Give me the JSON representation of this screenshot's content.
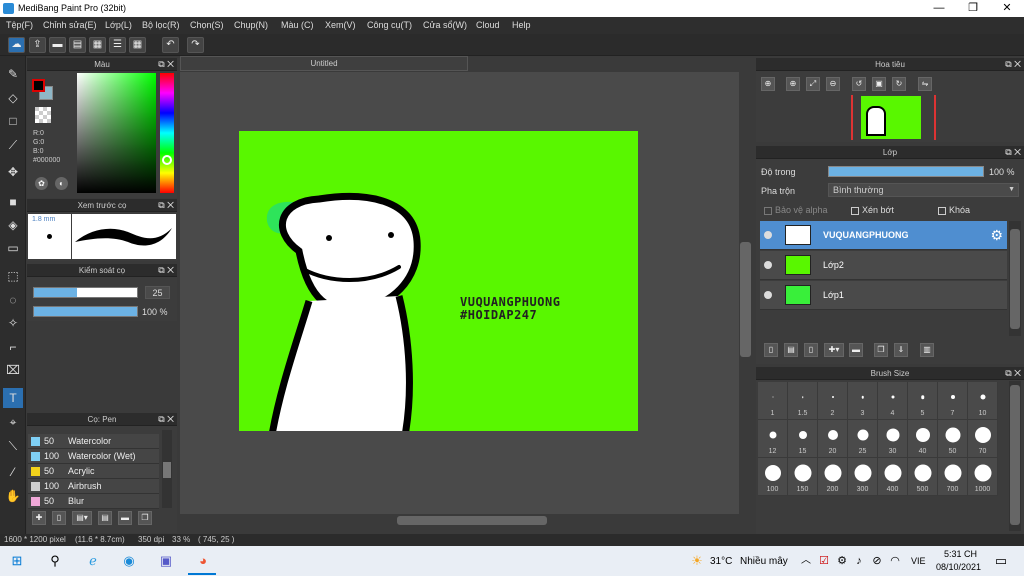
{
  "window": {
    "title": "MediBang Paint Pro (32bit)",
    "min": "—",
    "max": "❐",
    "close": "✕"
  },
  "menu": [
    "Tệp(F)",
    "Chỉnh sửa(E)",
    "Lớp(L)",
    "Bộ lọc(R)",
    "Chọn(S)",
    "Chụp(N)",
    "Màu (C)",
    "Xem(V)",
    "Công cụ(T)",
    "Cửa sổ(W)",
    "Cloud",
    "Help"
  ],
  "canvas": {
    "tab": "Untitled",
    "text_line1": "VUQUANGPHUONG",
    "text_line2": "#HOIDAP247",
    "bg_color": "#59f700"
  },
  "color_panel": {
    "title": "Màu",
    "r": "R:0",
    "g": "G:0",
    "b": "B:0",
    "hex": "#000000"
  },
  "preview_panel": {
    "title": "Xem trước cọ",
    "size": "1.8 mm"
  },
  "brush_control": {
    "title": "Kiểm soát cọ",
    "size_value": "25",
    "opacity_value": "100 %",
    "size_fill": 0.42,
    "opacity_fill": 1.0
  },
  "brush_panel": {
    "title": "Cọ: Pen",
    "items": [
      {
        "size": "50",
        "name": "Watercolor",
        "color": "#7fd0f5"
      },
      {
        "size": "100",
        "name": "Watercolor (Wet)",
        "color": "#7fd0f5"
      },
      {
        "size": "50",
        "name": "Acrylic",
        "color": "#f2d21b"
      },
      {
        "size": "100",
        "name": "Airbrush",
        "color": "#cfcfcf"
      },
      {
        "size": "50",
        "name": "Blur",
        "color": "#f0a8d8"
      }
    ]
  },
  "navigator": {
    "title": "Hoa tiêu"
  },
  "layer_panel": {
    "title": "Lớp",
    "opacity_label": "Độ trong",
    "opacity_value": "100 %",
    "blend_label": "Pha trộn",
    "blend_value": "Bình thường",
    "protect_alpha": "Bảo vệ alpha",
    "clipping": "Xén bớt",
    "lock": "Khóa",
    "layers": [
      "VUQUANGPHUONG",
      "Lớp2",
      "Lớp1"
    ]
  },
  "brush_size": {
    "title": "Brush Size",
    "sizes": [
      "1",
      "1.5",
      "2",
      "3",
      "4",
      "5",
      "7",
      "10",
      "12",
      "15",
      "20",
      "25",
      "30",
      "40",
      "50",
      "70",
      "100",
      "150",
      "200",
      "300",
      "400",
      "500",
      "700",
      "1000"
    ]
  },
  "status": {
    "dims": "1600 * 1200 pixel",
    "cm": "(11.6 * 8.7cm)",
    "dpi": "350 dpi",
    "zoom": "33 %",
    "coords": "( 745, 25 )"
  },
  "taskbar": {
    "weather_temp": "31°C",
    "weather_text": "Nhiều mây",
    "lang": "VIE",
    "time": "5:31 CH",
    "date": "08/10/2021"
  }
}
